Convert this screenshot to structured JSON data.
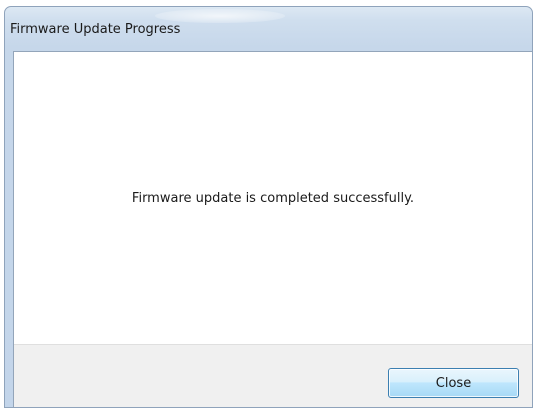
{
  "window": {
    "title": "Firmware Update Progress"
  },
  "content": {
    "message": "Firmware update is completed successfully."
  },
  "footer": {
    "close_label": "Close"
  }
}
